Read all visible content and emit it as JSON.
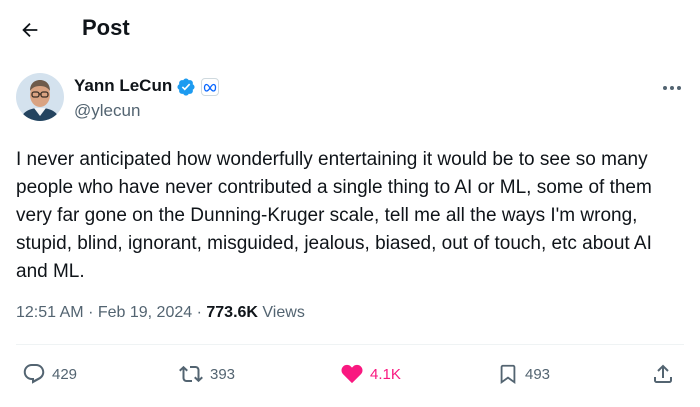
{
  "header": {
    "title": "Post"
  },
  "post": {
    "author": {
      "name": "Yann LeCun",
      "handle": "@ylecun"
    },
    "text": "I never anticipated how wonderfully entertaining it would be to see so many people who have never contributed a single thing to AI or ML, some of them very far gone on the Dunning-Kruger scale, tell me all the ways I'm wrong, stupid, blind, ignorant, misguided, jealous, biased, out of touch, etc about AI and ML.",
    "time": "12:51 AM",
    "separator": "·",
    "date": "Feb 19, 2024",
    "views_count": "773.6K",
    "views_label": "Views"
  },
  "actions": {
    "replies": "429",
    "reposts": "393",
    "likes": "4.1K",
    "bookmarks": "493"
  },
  "icons": {
    "back": "arrow-left-icon",
    "verified": "verified-badge-icon",
    "affiliate": "meta-logo-icon",
    "more": "more-horizontal-icon",
    "reply": "speech-bubble-icon",
    "repost": "repost-arrows-icon",
    "like": "heart-filled-icon",
    "bookmark": "bookmark-icon",
    "share": "share-upload-icon"
  },
  "colors": {
    "text": "#0f1419",
    "muted": "#536471",
    "verified": "#1d9bf0",
    "like": "#f91880",
    "divider": "#eff3f4"
  }
}
